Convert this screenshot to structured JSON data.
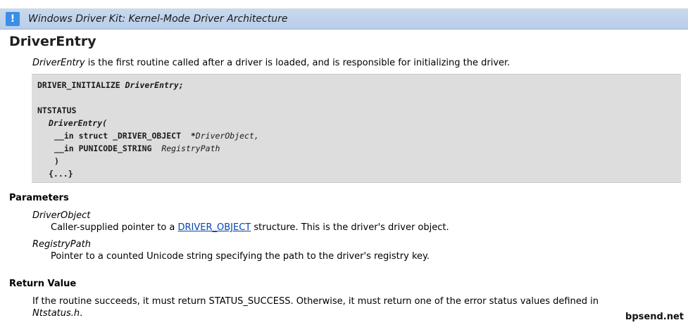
{
  "banner": {
    "icon": "exclamation-icon",
    "title": "Windows Driver Kit: Kernel-Mode Driver Architecture"
  },
  "page": {
    "title": "DriverEntry",
    "intro_em": "DriverEntry",
    "intro_rest": " is the first routine called after a driver is loaded, and is responsible for initializing the driver."
  },
  "code": {
    "line1_a": "DRIVER_INITIALIZE ",
    "line1_b": "DriverEntry;",
    "line2": "NTSTATUS",
    "line3": "DriverEntry(",
    "line4_a": "__in struct _DRIVER_OBJECT  *",
    "line4_b": "DriverObject,",
    "line5_a": "__in PUNICODE_STRING  ",
    "line5_b": "RegistryPath",
    "line6": ")",
    "line7": "{...}"
  },
  "parameters": {
    "heading": "Parameters",
    "items": [
      {
        "name": "DriverObject",
        "desc_before": "Caller-supplied pointer to a ",
        "link": "DRIVER_OBJECT",
        "desc_after": " structure. This is the driver's driver object."
      },
      {
        "name": "RegistryPath",
        "desc": "Pointer to a counted Unicode string specifying the path to the driver's registry key."
      }
    ]
  },
  "return_value": {
    "heading": "Return Value",
    "line1": "If the routine succeeds, it must return STATUS_SUCCESS. Otherwise, it must return one of the error status values defined in",
    "line2_em": "Ntstatus.h",
    "line2_rest": "."
  },
  "watermark": "bpsend.net"
}
